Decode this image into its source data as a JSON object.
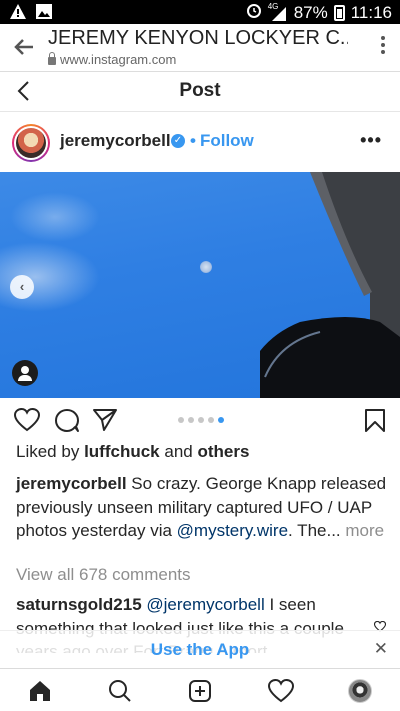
{
  "status_bar": {
    "network": "4G",
    "battery": "87%",
    "time": "11:16"
  },
  "browser": {
    "title": "JEREMY KENYON LOCKYER C...",
    "url": "www.instagram.com"
  },
  "page": {
    "title": "Post"
  },
  "post": {
    "username": "jeremycorbell",
    "follow_label": "Follow",
    "likes": {
      "prefix": "Liked by",
      "user": "luffchuck",
      "middle": "and",
      "suffix": "others"
    },
    "caption": {
      "username": "jeremycorbell",
      "text1": "So crazy. George Knapp released previously unseen military captured UFO / UAP photos yesterday via",
      "mention": "@mystery.wire",
      "text2": ". The...",
      "more": "more"
    },
    "view_all_comments": "View all 678 comments",
    "comment": {
      "username": "saturnsgold215",
      "mention": "@jeremycorbell",
      "text": "I seen something that looked just like this a couple years ago over Fort Bragg Airport"
    },
    "carousel": {
      "count": 5,
      "active_index": 4
    }
  },
  "banner": {
    "label": "Use the App"
  },
  "icons": {
    "accent": "#3897f0",
    "text": "#262626",
    "muted": "#8e8e8e"
  }
}
